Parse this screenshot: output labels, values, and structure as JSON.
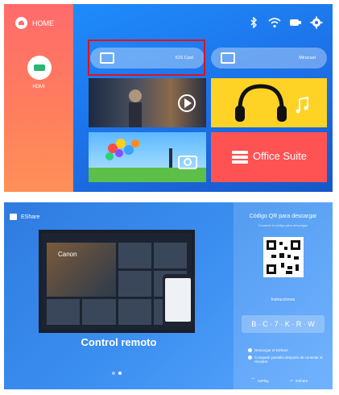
{
  "top": {
    "sidebar": {
      "home_label": "HOME",
      "hdmi_label": "HDMI"
    },
    "status_icons": [
      "bluetooth-icon",
      "wifi-icon",
      "input-icon",
      "gear-icon"
    ],
    "pills": {
      "ios_label": "IOS Cast",
      "miracast_label": "Miracast"
    },
    "tiles": {
      "office_label": "Office Suite"
    },
    "colors": {
      "highlight_border": "#e0121b",
      "sidebar": "#ff6b6b",
      "main": "#1d6fe6"
    }
  },
  "bottom": {
    "brand": "EShare",
    "qr_title": "Código QR para descargar",
    "qr_subtitle": "Escanee el código para descargar",
    "instructions_label": "Instrucciones",
    "pin": "B · C · 7 · K · R · W",
    "steps": [
      "Descargar el EShare",
      "Compartir pantalla después de conectar al receptor"
    ],
    "footer": {
      "left": "AirPlay",
      "right": "EShare"
    },
    "feature_title": "Control remoto",
    "tv_brand": "Canon"
  }
}
